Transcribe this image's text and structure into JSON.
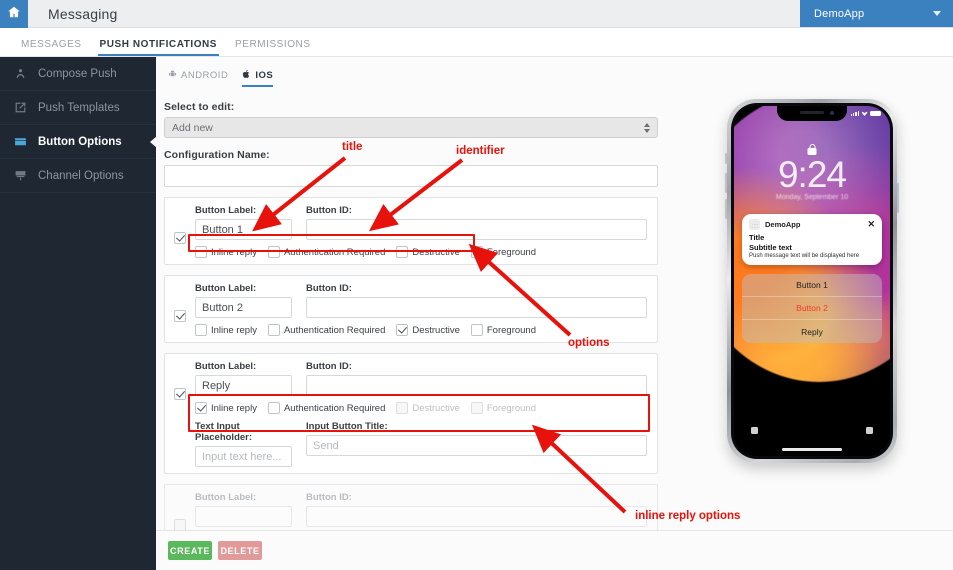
{
  "header": {
    "home_icon": "home-icon",
    "title": "Messaging",
    "account": "DemoApp"
  },
  "tabs": [
    {
      "label": "MESSAGES",
      "active": false
    },
    {
      "label": "PUSH NOTIFICATIONS",
      "active": true
    },
    {
      "label": "PERMISSIONS",
      "active": false
    }
  ],
  "sidebar": {
    "items": [
      {
        "label": "Compose Push",
        "icon": "compose-push-icon",
        "active": false
      },
      {
        "label": "Push Templates",
        "icon": "push-templates-icon",
        "active": false
      },
      {
        "label": "Button Options",
        "icon": "button-options-icon",
        "active": true
      },
      {
        "label": "Channel Options",
        "icon": "channel-options-icon",
        "active": false
      }
    ]
  },
  "platform_tabs": [
    {
      "label": "ANDROID",
      "icon": "android-icon",
      "active": false
    },
    {
      "label": "IOS",
      "icon": "apple-icon",
      "active": true
    }
  ],
  "form": {
    "select_to_edit_label": "Select to edit:",
    "select_to_edit_value": "Add new",
    "configuration_name_label": "Configuration Name:",
    "configuration_name_value": "",
    "button_label_label": "Button Label:",
    "button_id_label": "Button ID:",
    "text_input_placeholder_label": "Text Input Placeholder:",
    "input_button_title_label": "Input Button Title:",
    "options": {
      "inline_reply": "Inline reply",
      "authentication_required": "Authentication Required",
      "destructive": "Destructive",
      "foreground": "Foreground"
    },
    "rows": [
      {
        "enabled": true,
        "disabled": false,
        "label_value": "Button 1",
        "id_value": "",
        "inline_reply": false,
        "authentication_required": false,
        "destructive": false,
        "foreground": false,
        "opts_disabled": false,
        "show_inline_fields": false
      },
      {
        "enabled": true,
        "disabled": false,
        "label_value": "Button 2",
        "id_value": "",
        "inline_reply": false,
        "authentication_required": false,
        "destructive": true,
        "foreground": false,
        "opts_disabled": false,
        "show_inline_fields": false
      },
      {
        "enabled": true,
        "disabled": false,
        "label_value": "Reply",
        "id_value": "",
        "inline_reply": true,
        "authentication_required": false,
        "destructive": false,
        "foreground": false,
        "opts_disabled": true,
        "show_inline_fields": true,
        "text_input_placeholder_value": "Input text here...",
        "input_button_title_value": "Send"
      },
      {
        "enabled": false,
        "disabled": true,
        "label_value": "",
        "id_value": "",
        "inline_reply": false,
        "authentication_required": false,
        "destructive": false,
        "foreground": false,
        "opts_disabled": true,
        "show_inline_fields": false
      }
    ],
    "create_button": "CREATE",
    "delete_button": "DELETE"
  },
  "preview": {
    "clock": "9:24",
    "date": "Monday, September 10",
    "notification": {
      "app_name": "DemoApp",
      "close_icon": "close-icon",
      "title": "Title",
      "subtitle": "Subtitle text",
      "body": "Push message text will be displayed here"
    },
    "actions": [
      {
        "label": "Button 1",
        "destructive": false
      },
      {
        "label": "Button 2",
        "destructive": true
      },
      {
        "label": "Reply",
        "destructive": false
      }
    ]
  },
  "annotations": {
    "color": "#e8120c",
    "title": "title",
    "identifier": "identifier",
    "options": "options",
    "inline_reply_options": "inline reply options"
  }
}
